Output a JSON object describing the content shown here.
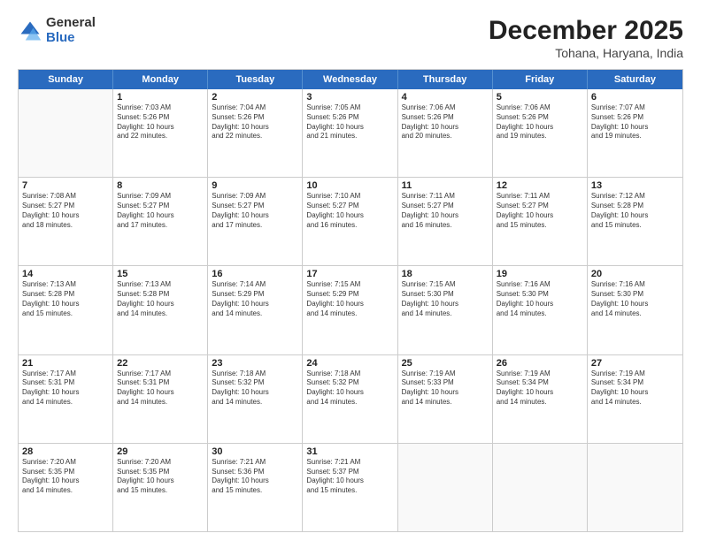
{
  "logo": {
    "general": "General",
    "blue": "Blue"
  },
  "title": {
    "month": "December 2025",
    "location": "Tohana, Haryana, India"
  },
  "header_days": [
    "Sunday",
    "Monday",
    "Tuesday",
    "Wednesday",
    "Thursday",
    "Friday",
    "Saturday"
  ],
  "rows": [
    [
      {
        "day": "",
        "info": ""
      },
      {
        "day": "1",
        "info": "Sunrise: 7:03 AM\nSunset: 5:26 PM\nDaylight: 10 hours\nand 22 minutes."
      },
      {
        "day": "2",
        "info": "Sunrise: 7:04 AM\nSunset: 5:26 PM\nDaylight: 10 hours\nand 22 minutes."
      },
      {
        "day": "3",
        "info": "Sunrise: 7:05 AM\nSunset: 5:26 PM\nDaylight: 10 hours\nand 21 minutes."
      },
      {
        "day": "4",
        "info": "Sunrise: 7:06 AM\nSunset: 5:26 PM\nDaylight: 10 hours\nand 20 minutes."
      },
      {
        "day": "5",
        "info": "Sunrise: 7:06 AM\nSunset: 5:26 PM\nDaylight: 10 hours\nand 19 minutes."
      },
      {
        "day": "6",
        "info": "Sunrise: 7:07 AM\nSunset: 5:26 PM\nDaylight: 10 hours\nand 19 minutes."
      }
    ],
    [
      {
        "day": "7",
        "info": "Sunrise: 7:08 AM\nSunset: 5:27 PM\nDaylight: 10 hours\nand 18 minutes."
      },
      {
        "day": "8",
        "info": "Sunrise: 7:09 AM\nSunset: 5:27 PM\nDaylight: 10 hours\nand 17 minutes."
      },
      {
        "day": "9",
        "info": "Sunrise: 7:09 AM\nSunset: 5:27 PM\nDaylight: 10 hours\nand 17 minutes."
      },
      {
        "day": "10",
        "info": "Sunrise: 7:10 AM\nSunset: 5:27 PM\nDaylight: 10 hours\nand 16 minutes."
      },
      {
        "day": "11",
        "info": "Sunrise: 7:11 AM\nSunset: 5:27 PM\nDaylight: 10 hours\nand 16 minutes."
      },
      {
        "day": "12",
        "info": "Sunrise: 7:11 AM\nSunset: 5:27 PM\nDaylight: 10 hours\nand 15 minutes."
      },
      {
        "day": "13",
        "info": "Sunrise: 7:12 AM\nSunset: 5:28 PM\nDaylight: 10 hours\nand 15 minutes."
      }
    ],
    [
      {
        "day": "14",
        "info": "Sunrise: 7:13 AM\nSunset: 5:28 PM\nDaylight: 10 hours\nand 15 minutes."
      },
      {
        "day": "15",
        "info": "Sunrise: 7:13 AM\nSunset: 5:28 PM\nDaylight: 10 hours\nand 14 minutes."
      },
      {
        "day": "16",
        "info": "Sunrise: 7:14 AM\nSunset: 5:29 PM\nDaylight: 10 hours\nand 14 minutes."
      },
      {
        "day": "17",
        "info": "Sunrise: 7:15 AM\nSunset: 5:29 PM\nDaylight: 10 hours\nand 14 minutes."
      },
      {
        "day": "18",
        "info": "Sunrise: 7:15 AM\nSunset: 5:30 PM\nDaylight: 10 hours\nand 14 minutes."
      },
      {
        "day": "19",
        "info": "Sunrise: 7:16 AM\nSunset: 5:30 PM\nDaylight: 10 hours\nand 14 minutes."
      },
      {
        "day": "20",
        "info": "Sunrise: 7:16 AM\nSunset: 5:30 PM\nDaylight: 10 hours\nand 14 minutes."
      }
    ],
    [
      {
        "day": "21",
        "info": "Sunrise: 7:17 AM\nSunset: 5:31 PM\nDaylight: 10 hours\nand 14 minutes."
      },
      {
        "day": "22",
        "info": "Sunrise: 7:17 AM\nSunset: 5:31 PM\nDaylight: 10 hours\nand 14 minutes."
      },
      {
        "day": "23",
        "info": "Sunrise: 7:18 AM\nSunset: 5:32 PM\nDaylight: 10 hours\nand 14 minutes."
      },
      {
        "day": "24",
        "info": "Sunrise: 7:18 AM\nSunset: 5:32 PM\nDaylight: 10 hours\nand 14 minutes."
      },
      {
        "day": "25",
        "info": "Sunrise: 7:19 AM\nSunset: 5:33 PM\nDaylight: 10 hours\nand 14 minutes."
      },
      {
        "day": "26",
        "info": "Sunrise: 7:19 AM\nSunset: 5:34 PM\nDaylight: 10 hours\nand 14 minutes."
      },
      {
        "day": "27",
        "info": "Sunrise: 7:19 AM\nSunset: 5:34 PM\nDaylight: 10 hours\nand 14 minutes."
      }
    ],
    [
      {
        "day": "28",
        "info": "Sunrise: 7:20 AM\nSunset: 5:35 PM\nDaylight: 10 hours\nand 14 minutes."
      },
      {
        "day": "29",
        "info": "Sunrise: 7:20 AM\nSunset: 5:35 PM\nDaylight: 10 hours\nand 15 minutes."
      },
      {
        "day": "30",
        "info": "Sunrise: 7:21 AM\nSunset: 5:36 PM\nDaylight: 10 hours\nand 15 minutes."
      },
      {
        "day": "31",
        "info": "Sunrise: 7:21 AM\nSunset: 5:37 PM\nDaylight: 10 hours\nand 15 minutes."
      },
      {
        "day": "",
        "info": ""
      },
      {
        "day": "",
        "info": ""
      },
      {
        "day": "",
        "info": ""
      }
    ]
  ]
}
